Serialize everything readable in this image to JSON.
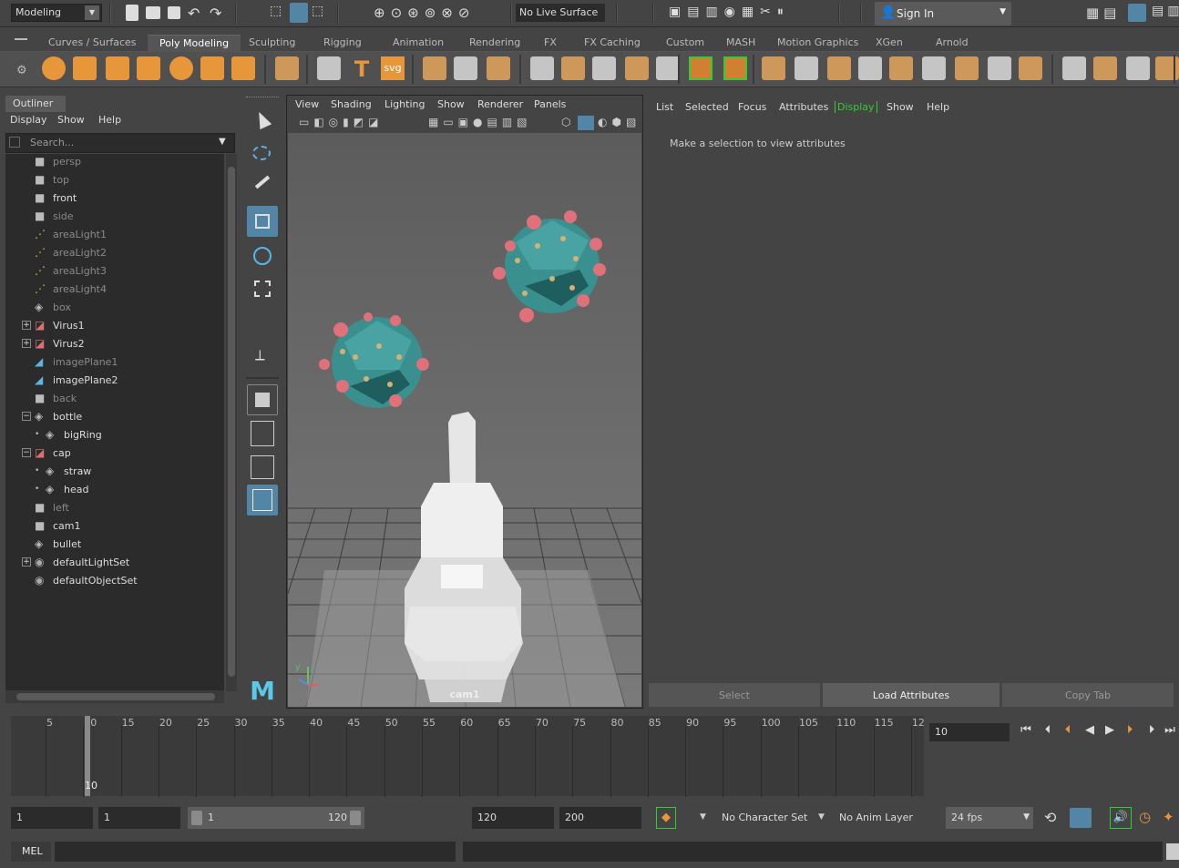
{
  "top": {
    "menu_set": "Modeling",
    "live_surface": "No Live Surface",
    "sign_in": "Sign In"
  },
  "shelf_tabs": [
    "Curves / Surfaces",
    "Poly Modeling",
    "Sculpting",
    "Rigging",
    "Animation",
    "Rendering",
    "FX",
    "FX Caching",
    "Custom",
    "MASH",
    "Motion Graphics",
    "XGen",
    "Arnold"
  ],
  "shelf_active": "Poly Modeling",
  "shelf_svg_label": "svg",
  "outliner": {
    "tab": "Outliner",
    "menu": [
      "Display",
      "Show",
      "Help"
    ],
    "search_placeholder": "Search...",
    "items": [
      {
        "label": "persp",
        "icon": "camera-icon",
        "dim": true,
        "indent": 0
      },
      {
        "label": "top",
        "icon": "camera-icon",
        "dim": true,
        "indent": 0
      },
      {
        "label": "front",
        "icon": "camera-icon",
        "dim": false,
        "indent": 0
      },
      {
        "label": "side",
        "icon": "camera-icon",
        "dim": true,
        "indent": 0
      },
      {
        "label": "areaLight1",
        "icon": "area-light-icon",
        "dim": true,
        "indent": 0
      },
      {
        "label": "areaLight2",
        "icon": "area-light-icon",
        "dim": true,
        "indent": 0
      },
      {
        "label": "areaLight3",
        "icon": "area-light-icon",
        "dim": true,
        "indent": 0
      },
      {
        "label": "areaLight4",
        "icon": "area-light-icon",
        "dim": true,
        "indent": 0
      },
      {
        "label": "box",
        "icon": "transform-icon",
        "dim": true,
        "indent": 0
      },
      {
        "label": "Virus1",
        "icon": "mesh-icon",
        "dim": false,
        "indent": 0,
        "expand": "+"
      },
      {
        "label": "Virus2",
        "icon": "mesh-icon",
        "dim": false,
        "indent": 0,
        "expand": "+"
      },
      {
        "label": "imagePlane1",
        "icon": "image-plane-icon",
        "dim": true,
        "indent": 0
      },
      {
        "label": "imagePlane2",
        "icon": "image-plane-icon",
        "dim": false,
        "indent": 0
      },
      {
        "label": "back",
        "icon": "camera-icon",
        "dim": true,
        "indent": 0
      },
      {
        "label": "bottle",
        "icon": "transform-icon",
        "dim": false,
        "indent": 0,
        "expand": "-"
      },
      {
        "label": "bigRing",
        "icon": "transform-icon",
        "dim": false,
        "indent": 1
      },
      {
        "label": "cap",
        "icon": "mesh-icon",
        "dim": false,
        "indent": 0,
        "expand": "-"
      },
      {
        "label": "straw",
        "icon": "transform-icon",
        "dim": false,
        "indent": 1
      },
      {
        "label": "head",
        "icon": "transform-icon",
        "dim": false,
        "indent": 1
      },
      {
        "label": "left",
        "icon": "camera-icon",
        "dim": true,
        "indent": 0
      },
      {
        "label": "cam1",
        "icon": "camera-icon",
        "dim": false,
        "indent": 0
      },
      {
        "label": "bullet",
        "icon": "transform-icon",
        "dim": false,
        "indent": 0
      },
      {
        "label": "defaultLightSet",
        "icon": "set-icon",
        "dim": false,
        "indent": 0,
        "expand": "+"
      },
      {
        "label": "defaultObjectSet",
        "icon": "set-icon",
        "dim": false,
        "indent": 0
      }
    ]
  },
  "viewport": {
    "menu": [
      "View",
      "Shading",
      "Lighting",
      "Show",
      "Renderer",
      "Panels"
    ],
    "camera_label": "cam1"
  },
  "attribute_editor": {
    "menu": [
      "List",
      "Selected",
      "Focus",
      "Attributes",
      "Display",
      "Show",
      "Help"
    ],
    "active_menu": "Display",
    "message": "Make a selection to view attributes",
    "buttons": [
      "Select",
      "Load Attributes",
      "Copy Tab"
    ]
  },
  "timeline": {
    "ticks": [
      "5",
      "10",
      "15",
      "20",
      "25",
      "30",
      "35",
      "40",
      "45",
      "50",
      "55",
      "60",
      "65",
      "70",
      "75",
      "80",
      "85",
      "90",
      "95",
      "100",
      "105",
      "110",
      "115",
      "12"
    ],
    "current_frame_marker": "10",
    "current_frame": "10"
  },
  "range": {
    "start": "1",
    "anim_start": "1",
    "slider_start": "1",
    "slider_end": "120",
    "end": "120",
    "anim_end": "200",
    "character_set": "No Character Set",
    "anim_layer": "No Anim Layer",
    "fps": "24 fps"
  },
  "command": {
    "label": "MEL"
  },
  "colors": {
    "accent": "#5285a6",
    "display_green": "#33cc33",
    "shelf_orange": "#e8963a",
    "virus_teal": "#3a8f8f",
    "spike_pink": "#e0707a"
  }
}
